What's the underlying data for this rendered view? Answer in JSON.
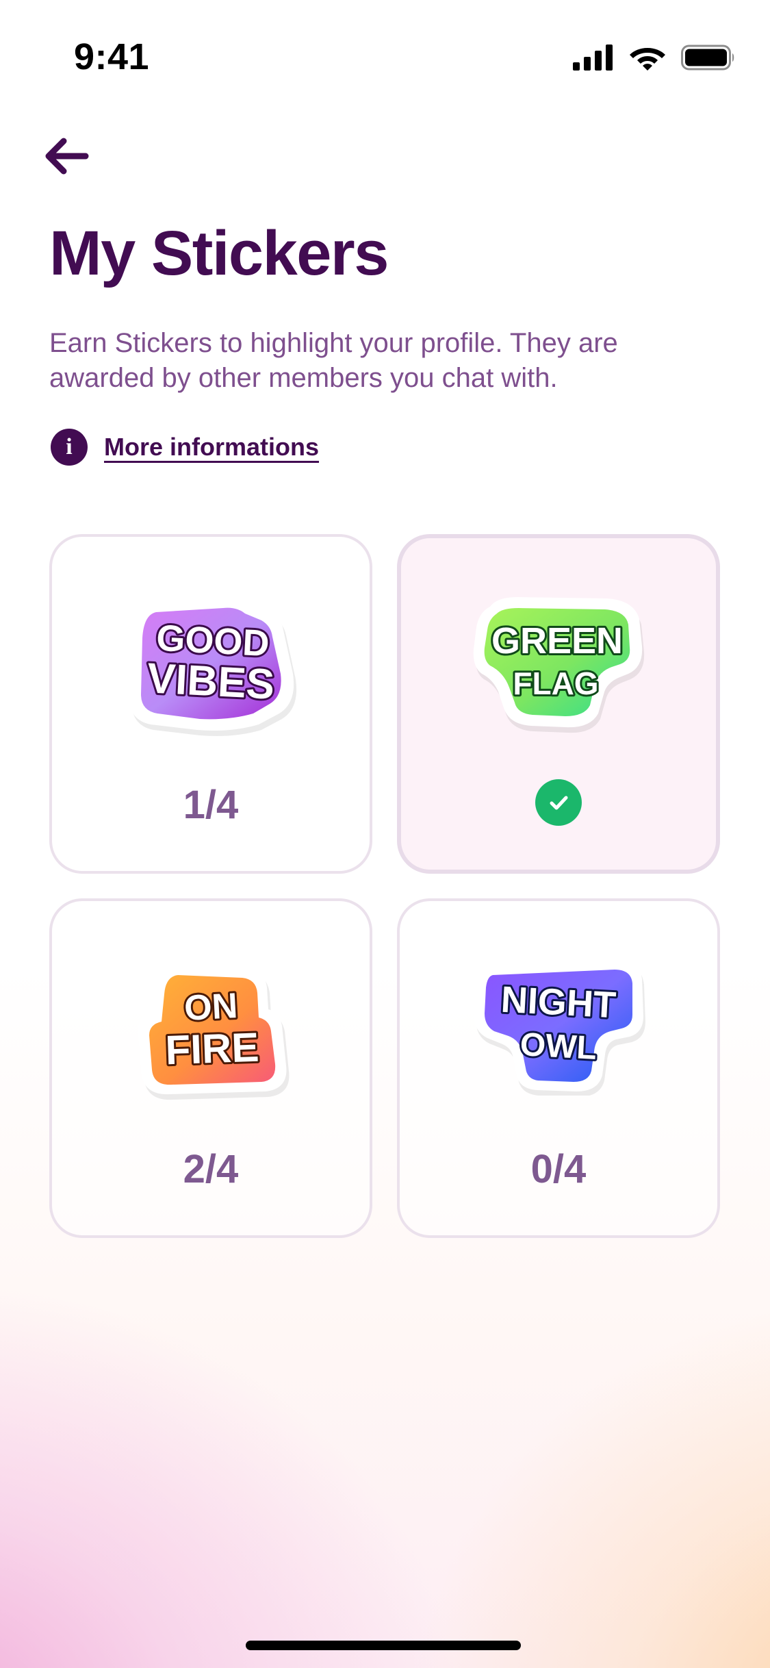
{
  "status_bar": {
    "time": "9:41"
  },
  "header": {
    "back_icon": "arrow-left-icon",
    "title": "My Stickers",
    "subtitle": "Earn Stickers to highlight your profile. They are awarded by other members you chat with.",
    "info_icon_glyph": "i",
    "info_link": "More informations"
  },
  "colors": {
    "primary": "#420c52",
    "muted_text": "#7e4f8e",
    "count_text": "#7e5990",
    "success": "#1bb76b",
    "card_border": "#ebe1ec",
    "selected_bg": "#fdf2f8"
  },
  "stickers": [
    {
      "line1": "GOOD",
      "line2": "VIBES",
      "count": "1/4",
      "selected": false,
      "gradient": [
        "#c26ff0",
        "#9b35d8"
      ]
    },
    {
      "line1": "GREEN",
      "line2": "FLAG",
      "count": "",
      "selected": true,
      "gradient": [
        "#9ef55a",
        "#3bd46c"
      ]
    },
    {
      "line1": "ON",
      "line2": "FIRE",
      "count": "2/4",
      "selected": false,
      "gradient": [
        "#ffb13d",
        "#f76a5f"
      ]
    },
    {
      "line1": "NIGHT",
      "line2": "OWL",
      "count": "0/4",
      "selected": false,
      "gradient": [
        "#7f56ff",
        "#2f56f5"
      ]
    }
  ]
}
